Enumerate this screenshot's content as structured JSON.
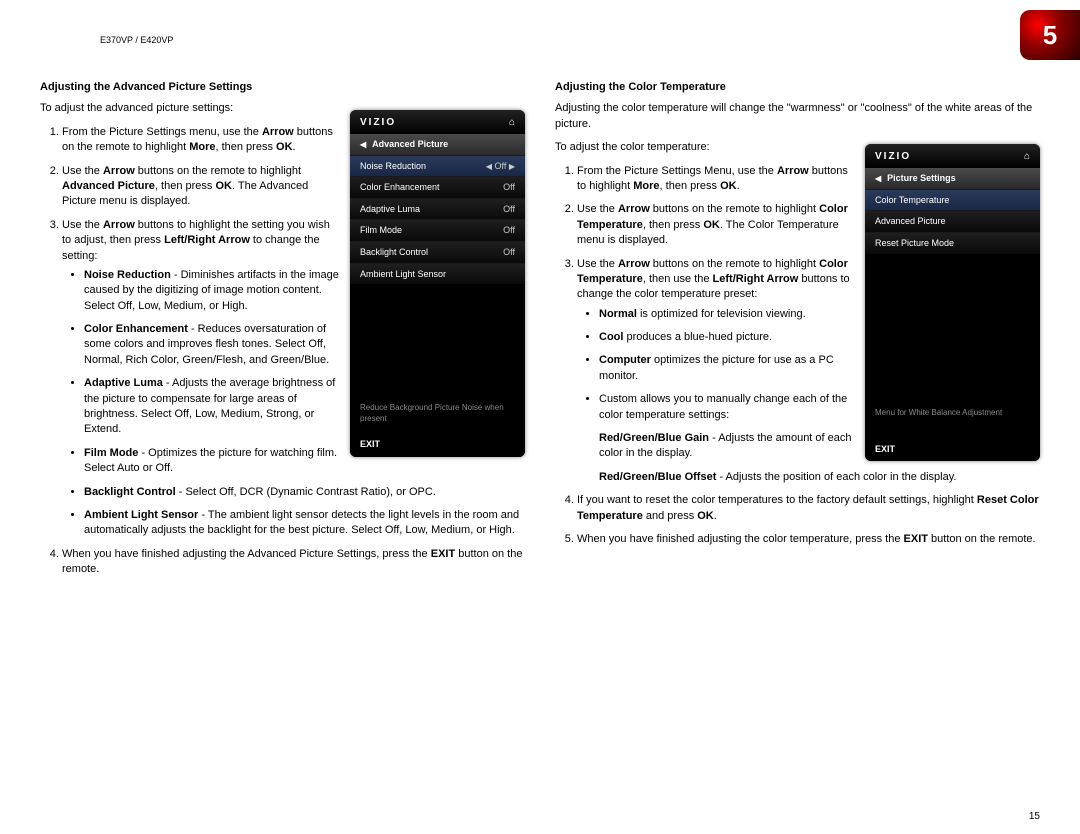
{
  "header": {
    "model": "E370VP / E420VP",
    "chapter": "5",
    "page_number": "15"
  },
  "left": {
    "heading": "Adjusting the Advanced Picture Settings",
    "intro": "To adjust the advanced picture settings:",
    "step1_a": "From the Picture Settings menu, use the ",
    "step1_b": "Arrow",
    "step1_c": " buttons on the remote to highlight ",
    "step1_d": "More",
    "step1_e": ", then press ",
    "step1_f": "OK",
    "step1_g": ".",
    "step2_a": "Use the ",
    "step2_b": "Arrow",
    "step2_c": " buttons on the remote to highlight ",
    "step2_d": "Advanced Picture",
    "step2_e": ", then press ",
    "step2_f": "OK",
    "step2_g": ". The Advanced Picture menu is displayed.",
    "step3_a": "Use the ",
    "step3_b": "Arrow",
    "step3_c": " buttons to highlight the setting you wish to adjust, then press ",
    "step3_d": "Left/Right Arrow",
    "step3_e": " to change the setting:",
    "b1_t": "Noise Reduction",
    "b1_d": " - Diminishes artifacts in the image caused by the digitizing of image motion content. Select Off, Low, Medium, or High.",
    "b2_t": "Color Enhancement",
    "b2_d": " - Reduces oversaturation of some colors and improves flesh tones. Select Off, Normal, Rich Color, Green/Flesh, and Green/Blue.",
    "b3_t": "Adaptive Luma",
    "b3_d": " - Adjusts the average brightness of the picture to compensate for large areas of brightness. Select Off, Low, Medium, Strong, or Extend.",
    "b4_t": "Film Mode",
    "b4_d": " - Optimizes the picture for watching film. Select Auto or Off.",
    "b5_t": "Backlight Control",
    "b5_d": " - Select Off, DCR (Dynamic Contrast Ratio), or OPC.",
    "b6_t": "Ambient Light Sensor",
    "b6_d": " - The ambient light sensor detects the light levels in the room and automatically adjusts the backlight for the best picture. Select Off, Low, Medium, or High.",
    "step4_a": "When you have finished adjusting the Advanced Picture Settings, press the ",
    "step4_b": "EXIT",
    "step4_c": " button on the remote.",
    "menu": {
      "brand": "VIZIO",
      "title": "Advanced Picture",
      "rows": [
        {
          "label": "Noise Reduction",
          "value": "Off",
          "hl": true,
          "arrows": true
        },
        {
          "label": "Color Enhancement",
          "value": "Off"
        },
        {
          "label": "Adaptive Luma",
          "value": "Off"
        },
        {
          "label": "Film Mode",
          "value": "Off"
        },
        {
          "label": "Backlight Control",
          "value": "Off"
        },
        {
          "label": "Ambient Light Sensor",
          "value": ""
        }
      ],
      "hint": "Reduce Background Picture Noise when present",
      "exit": "EXIT"
    }
  },
  "right": {
    "heading": "Adjusting the Color Temperature",
    "intro": "Adjusting the color temperature will change the \"warmness\" or \"coolness\" of the white areas of the picture.",
    "intro2": "To adjust the color temperature:",
    "step1_a": "From the Picture Settings Menu, use the ",
    "step1_b": "Arrow",
    "step1_c": " buttons to highlight ",
    "step1_d": "More",
    "step1_e": ", then press ",
    "step1_f": "OK",
    "step1_g": ".",
    "step2_a": "Use the ",
    "step2_b": "Arrow",
    "step2_c": " buttons on the remote to highlight ",
    "step2_d": "Color Temperature",
    "step2_e": ", then press ",
    "step2_f": "OK",
    "step2_g": ". The Color Temperature menu is displayed.",
    "step3_a": "Use the ",
    "step3_b": "Arrow",
    "step3_c": " buttons on the remote to highlight ",
    "step3_d": "Color Temperature",
    "step3_e": ", then use the ",
    "step3_f": "Left/Right Arrow",
    "step3_g": " buttons to change the color temperature preset:",
    "b1_t": "Normal",
    "b1_d": " is optimized for television viewing.",
    "b2_t": "Cool",
    "b2_d": " produces a blue-hued picture.",
    "b3_t": "Computer",
    "b3_d": " optimizes the picture for use as a PC monitor.",
    "b4": "Custom allows you to manually change each of the color temperature settings:",
    "sub1_t": "Red/Green/Blue Gain",
    "sub1_d": " - Adjusts the amount of each color in the display.",
    "sub2_t": "Red/Green/Blue Offset",
    "sub2_d": " - Adjusts the position of each color in the display.",
    "step4_a": "If you want to reset the color temperatures to the factory default settings, highlight ",
    "step4_b": "Reset Color Temperature",
    "step4_c": " and press ",
    "step4_d": "OK",
    "step4_e": ".",
    "step5_a": "When you have finished adjusting the color temperature, press the ",
    "step5_b": "EXIT",
    "step5_c": " button on the remote.",
    "menu": {
      "brand": "VIZIO",
      "title": "Picture Settings",
      "rows": [
        {
          "label": "Color Temperature",
          "value": "",
          "hl": true
        },
        {
          "label": "Advanced Picture",
          "value": ""
        },
        {
          "label": "Reset Picture Mode",
          "value": ""
        }
      ],
      "hint": "Menu for White Balance Adjustment",
      "exit": "EXIT"
    }
  }
}
